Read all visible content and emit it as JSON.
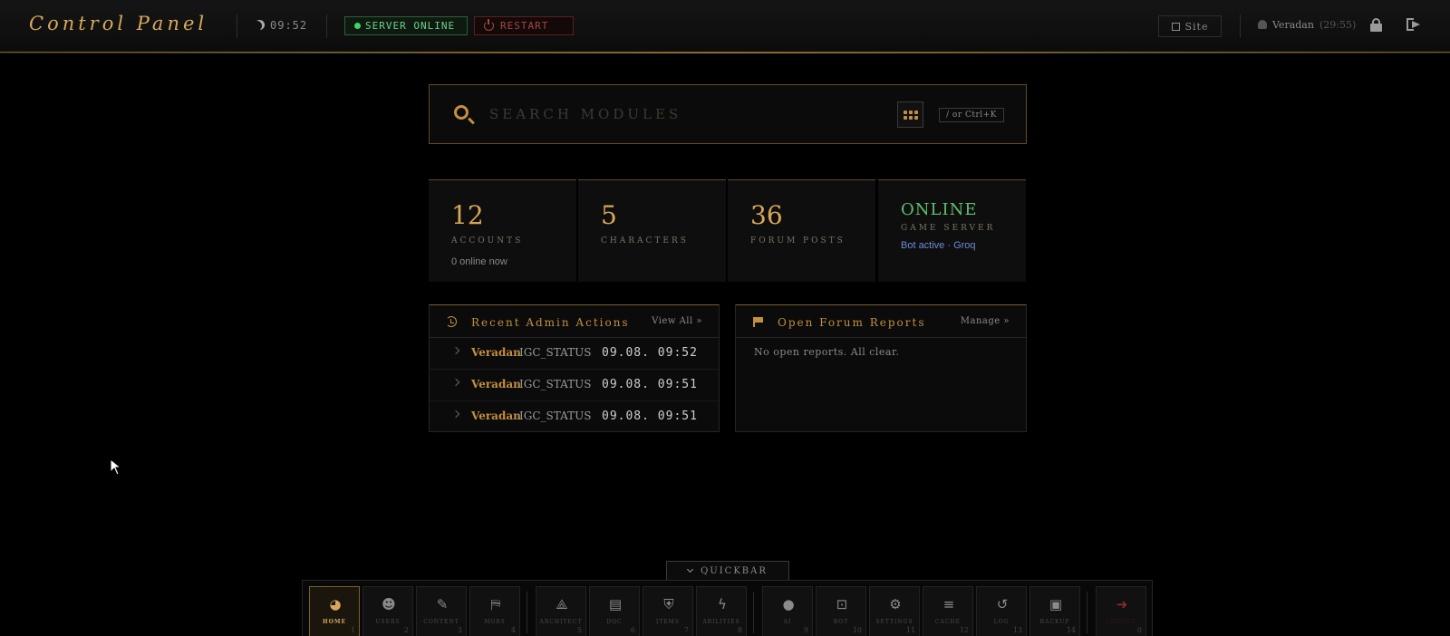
{
  "header": {
    "title": "Control Panel",
    "clock": "09:52",
    "server_status": "SERVER ONLINE",
    "restart_label": "RESTART",
    "site_label": "Site",
    "username": "Veradan",
    "session": "(29:55)"
  },
  "search": {
    "placeholder": "SEARCH MODULES",
    "shortcut": "/ or Ctrl+K"
  },
  "stats": [
    {
      "value": "12",
      "label": "ACCOUNTS",
      "sub": "0 online now"
    },
    {
      "value": "5",
      "label": "CHARACTERS",
      "sub": ""
    },
    {
      "value": "36",
      "label": "FORUM POSTS",
      "sub": ""
    },
    {
      "value": "ONLINE",
      "label": "GAME SERVER",
      "sub": "Bot active · Groq"
    }
  ],
  "recent_actions": {
    "title": "Recent Admin Actions",
    "link": "View All »",
    "rows": [
      {
        "who": "Veradan",
        "action": "IGC_STATUS",
        "time": "09.08. 09:52"
      },
      {
        "who": "Veradan",
        "action": "IGC_STATUS",
        "time": "09.08. 09:51"
      },
      {
        "who": "Veradan",
        "action": "IGC_STATUS",
        "time": "09.08. 09:51"
      }
    ]
  },
  "forum_reports": {
    "title": "Open Forum Reports",
    "link": "Manage »",
    "empty": "No open reports. All clear."
  },
  "quickbar": {
    "label": "QUICKBAR",
    "items": [
      {
        "label": "HOME",
        "num": "1",
        "icon": "gauge-icon"
      },
      {
        "label": "USERS",
        "num": "2",
        "icon": "users-icon"
      },
      {
        "label": "CONTENT",
        "num": "3",
        "icon": "edit-icon"
      },
      {
        "label": "MOBS",
        "num": "4",
        "icon": "map-icon"
      },
      {
        "label": "ARCHITECT",
        "num": "5",
        "icon": "compass-icon"
      },
      {
        "label": "DQC",
        "num": "6",
        "icon": "scroll-icon"
      },
      {
        "label": "ITEMS",
        "num": "7",
        "icon": "shield-icon"
      },
      {
        "label": "ABILITIES",
        "num": "8",
        "icon": "bolt-icon"
      },
      {
        "label": "AI",
        "num": "9",
        "icon": "bulb-icon"
      },
      {
        "label": "BOT",
        "num": "10",
        "icon": "robot-icon"
      },
      {
        "label": "SETTINGS",
        "num": "11",
        "icon": "gear-icon"
      },
      {
        "label": "CACHE",
        "num": "12",
        "icon": "database-icon"
      },
      {
        "label": "LOG",
        "num": "13",
        "icon": "history-icon"
      },
      {
        "label": "BACKUP",
        "num": "14",
        "icon": "archive-icon"
      },
      {
        "label": "LOGOUT",
        "num": "0",
        "icon": "logout-icon"
      }
    ]
  },
  "colors": {
    "accent": "#c48f3f",
    "online": "#5fbf6e",
    "danger": "#a8453f"
  }
}
